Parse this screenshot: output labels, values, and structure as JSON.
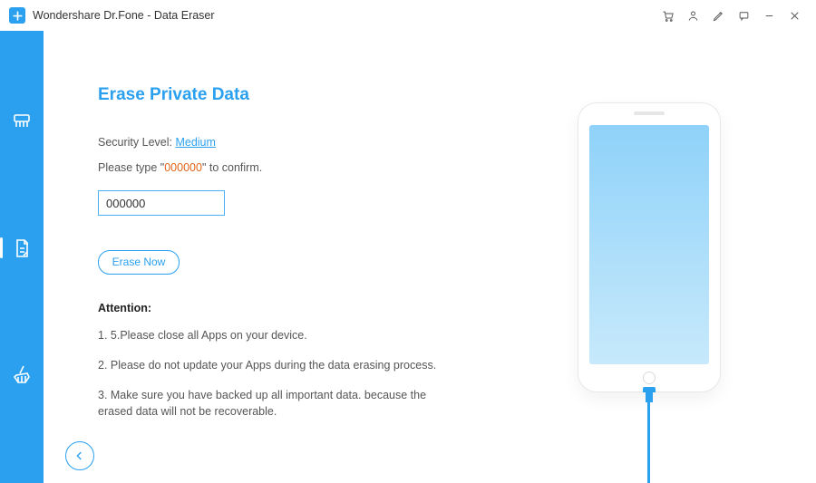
{
  "window": {
    "title": "Wondershare Dr.Fone - Data Eraser"
  },
  "main": {
    "heading": "Erase Private Data",
    "security_label": "Security Level: ",
    "security_value": "Medium",
    "type_prefix": "Please type \"",
    "confirm_code": "000000",
    "type_suffix": "\" to confirm.",
    "input_value": "000000",
    "erase_button": "Erase Now",
    "attention_title": "Attention:",
    "attention": [
      "1. 5.Please close all Apps on your device.",
      "2. Please do not update your Apps during the data erasing process.",
      "3. Make sure you have backed up all important data. because the erased data will not be recoverable."
    ]
  }
}
